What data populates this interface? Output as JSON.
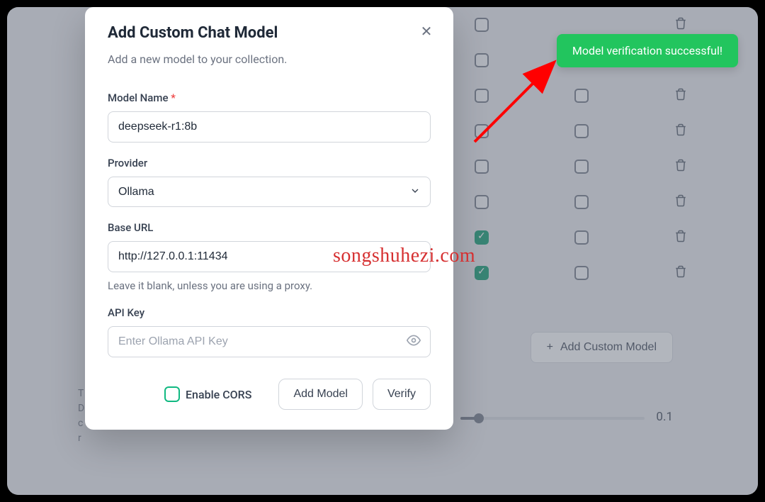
{
  "modal": {
    "title": "Add Custom Chat Model",
    "subtitle": "Add a new model to your collection.",
    "model_name_label": "Model Name",
    "model_name_value": "deepseek-r1:8b",
    "provider_label": "Provider",
    "provider_value": "Ollama",
    "base_url_label": "Base URL",
    "base_url_value": "http://127.0.0.1:11434",
    "base_url_helper": "Leave it blank, unless you are using a proxy.",
    "api_key_label": "API Key",
    "api_key_placeholder": "Enter Ollama API Key",
    "enable_cors_label": "Enable CORS",
    "add_model_button": "Add Model",
    "verify_button": "Verify"
  },
  "toast": {
    "message": "Model verification successful!"
  },
  "background": {
    "add_custom_model_button": "Add Custom Model",
    "slider_value": "0.1"
  },
  "watermark": "songshuhezi.com"
}
